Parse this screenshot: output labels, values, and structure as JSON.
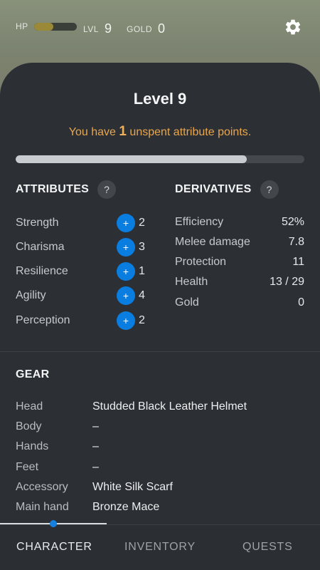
{
  "hud": {
    "hp_label": "HP",
    "hp_fraction": 0.45,
    "lvl_label": "LVL",
    "lvl_value": "9",
    "gold_label": "GOLD",
    "gold_value": "0",
    "settings_icon": "gear-icon"
  },
  "header": {
    "title": "Level 9",
    "unspent_prefix": "You have",
    "unspent_count": "1",
    "unspent_suffix": "unspent attribute points.",
    "xp_fraction": 0.8
  },
  "attributes": {
    "title": "ATTRIBUTES",
    "help": "?",
    "plus": "+",
    "items": [
      {
        "name": "Strength",
        "value": "2"
      },
      {
        "name": "Charisma",
        "value": "3"
      },
      {
        "name": "Resilience",
        "value": "1"
      },
      {
        "name": "Agility",
        "value": "4"
      },
      {
        "name": "Perception",
        "value": "2"
      }
    ]
  },
  "derivatives": {
    "title": "DERIVATIVES",
    "help": "?",
    "items": [
      {
        "name": "Efficiency",
        "value": "52%"
      },
      {
        "name": "Melee damage",
        "value": "7.8"
      },
      {
        "name": "Protection",
        "value": "11"
      },
      {
        "name": "Health",
        "value": "13 / 29"
      },
      {
        "name": "Gold",
        "value": "0"
      }
    ]
  },
  "gear": {
    "title": "GEAR",
    "items": [
      {
        "slot": "Head",
        "item": "Studded Black Leather Helmet"
      },
      {
        "slot": "Body",
        "item": "–"
      },
      {
        "slot": "Hands",
        "item": "–"
      },
      {
        "slot": "Feet",
        "item": "–"
      },
      {
        "slot": "Accessory",
        "item": "White Silk Scarf"
      },
      {
        "slot": "Main hand",
        "item": "Bronze Mace"
      }
    ]
  },
  "nav": {
    "tabs": [
      {
        "label": "CHARACTER",
        "active": true
      },
      {
        "label": "INVENTORY",
        "active": false
      },
      {
        "label": "QUESTS",
        "active": false
      }
    ]
  },
  "colors": {
    "accent_blue": "#0a7ee0",
    "unspent_orange": "#e8a64f",
    "panel_bg": "#2c2f33"
  }
}
